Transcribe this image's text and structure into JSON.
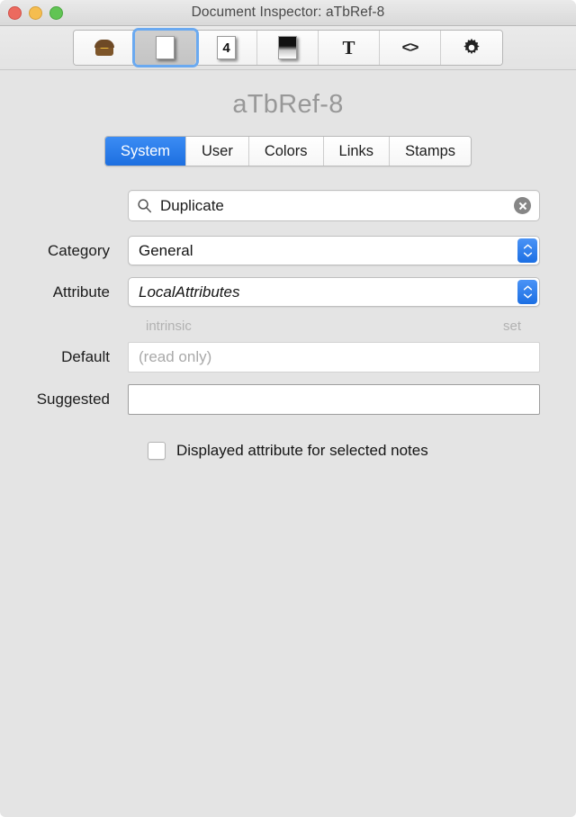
{
  "window": {
    "title": "Document Inspector: aTbRef-8",
    "traffic_lights": [
      {
        "name": "close",
        "color": "#ec6a5f"
      },
      {
        "name": "minimize",
        "color": "#f5bd4f"
      },
      {
        "name": "zoom",
        "color": "#61c454"
      }
    ]
  },
  "toolbar": {
    "items": [
      {
        "icon": "treasure-chest-icon",
        "selected": false
      },
      {
        "icon": "blank-page-icon",
        "selected": true
      },
      {
        "icon": "numbered-page-icon",
        "label": "4",
        "selected": false
      },
      {
        "icon": "gradient-page-icon",
        "selected": false
      },
      {
        "icon": "text-icon",
        "label": "T",
        "selected": false
      },
      {
        "icon": "code-icon",
        "label": "<>",
        "selected": false
      },
      {
        "icon": "gear-icon",
        "selected": false
      }
    ]
  },
  "document_name": "aTbRef-8",
  "tabs": [
    {
      "label": "System",
      "active": true
    },
    {
      "label": "User",
      "active": false
    },
    {
      "label": "Colors",
      "active": false
    },
    {
      "label": "Links",
      "active": false
    },
    {
      "label": "Stamps",
      "active": false
    }
  ],
  "search": {
    "value": "Duplicate",
    "placeholder": "Search",
    "icon": "search-icon",
    "clear_icon": "clear-icon"
  },
  "fields": {
    "category": {
      "label": "Category",
      "value": "General"
    },
    "attribute": {
      "label": "Attribute",
      "value": "LocalAttributes"
    },
    "sublabels": {
      "left": "intrinsic",
      "right": "set"
    },
    "default": {
      "label": "Default",
      "value": "",
      "placeholder": "(read only)"
    },
    "suggested": {
      "label": "Suggested",
      "value": "",
      "placeholder": ""
    }
  },
  "checkbox": {
    "label": "Displayed attribute for selected notes",
    "checked": false
  },
  "colors": {
    "accent_blue": "#1d6fe0",
    "window_bg": "#e4e4e4",
    "title_text": "#4a4a4a",
    "doc_title_text": "#989898",
    "sublabel_text": "#b2b2b2"
  }
}
